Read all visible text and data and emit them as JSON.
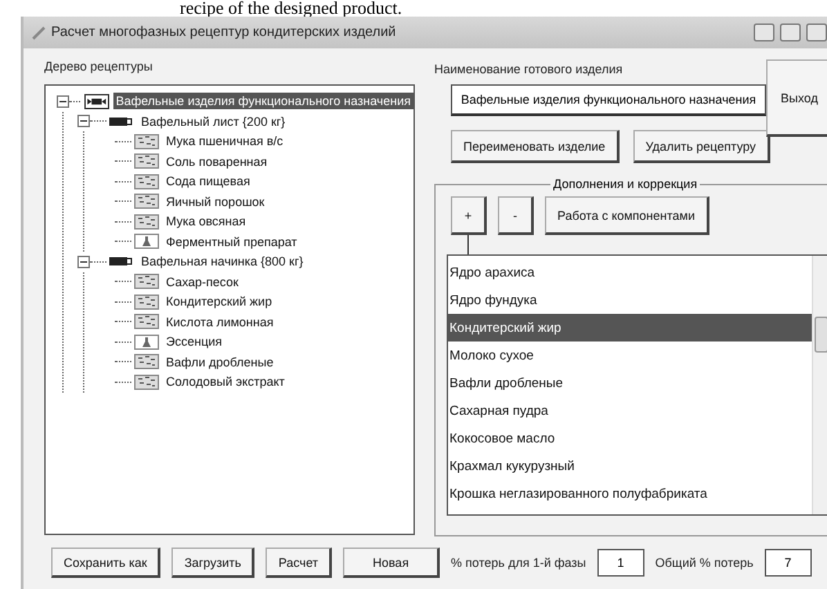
{
  "caption": "recipe of the designed product.",
  "window": {
    "title": "Расчет многофазных рецептур кондитерских изделий"
  },
  "tree": {
    "label": "Дерево рецептуры",
    "items": [
      {
        "label": "Вафельные изделия функционального назначения",
        "kind": "product",
        "selected": true,
        "expanded": true,
        "children": [
          {
            "label": "Вафельный лист {200 кг}",
            "kind": "phase",
            "selected": false,
            "expanded": true,
            "children": [
              {
                "label": "Мука пшеничная в/с",
                "kind": "ingredient",
                "selected": false
              },
              {
                "label": "Соль поваренная",
                "kind": "ingredient",
                "selected": false
              },
              {
                "label": "Сода пищевая",
                "kind": "ingredient",
                "selected": false
              },
              {
                "label": "Яичный порошок",
                "kind": "ingredient",
                "selected": false
              },
              {
                "label": "Мука овсяная",
                "kind": "ingredient",
                "selected": false
              },
              {
                "label": "Ферментный препарат",
                "kind": "additive",
                "selected": false
              }
            ]
          },
          {
            "label": "Вафельная начинка {800 кг}",
            "kind": "phase",
            "selected": false,
            "expanded": true,
            "children": [
              {
                "label": "Сахар-песок",
                "kind": "ingredient",
                "selected": false
              },
              {
                "label": "Кондитерский жир",
                "kind": "ingredient",
                "selected": false
              },
              {
                "label": "Кислота лимонная",
                "kind": "ingredient",
                "selected": false
              },
              {
                "label": "Эссенция",
                "kind": "additive",
                "selected": false
              },
              {
                "label": "Вафли дробленые",
                "kind": "ingredient",
                "selected": false
              },
              {
                "label": "Солодовый экстракт",
                "kind": "ingredient",
                "selected": false
              }
            ]
          }
        ]
      }
    ]
  },
  "product": {
    "label": "Наименование готового изделия",
    "value": "Вафельные изделия функционального назначения"
  },
  "exit_button": "Выход",
  "actions": [
    "Переименовать изделие",
    "Удалить рецептуру"
  ],
  "group": {
    "title": "Дополнения и коррекция",
    "buttons": [
      "+",
      "-",
      "Работа с компонентами"
    ],
    "list": [
      {
        "label": "Ядро арахиса",
        "selected": false
      },
      {
        "label": "Ядро фундука",
        "selected": false
      },
      {
        "label": "Кондитерский жир",
        "selected": true
      },
      {
        "label": "Молоко сухое",
        "selected": false
      },
      {
        "label": "Вафли дробленые",
        "selected": false
      },
      {
        "label": "Сахарная пудра",
        "selected": false
      },
      {
        "label": "Кокосовое масло",
        "selected": false
      },
      {
        "label": "Крахмал кукурузный",
        "selected": false
      },
      {
        "label": "Крошка неглазированного полуфабриката",
        "selected": false
      }
    ]
  },
  "footer": {
    "buttons": [
      "Сохранить как",
      "Загрузить",
      "Расчет",
      "Новая"
    ],
    "fields": [
      {
        "label": "% потерь для 1-й фазы",
        "value": "1"
      },
      {
        "label": "Общий % потерь",
        "value": "7"
      }
    ]
  }
}
